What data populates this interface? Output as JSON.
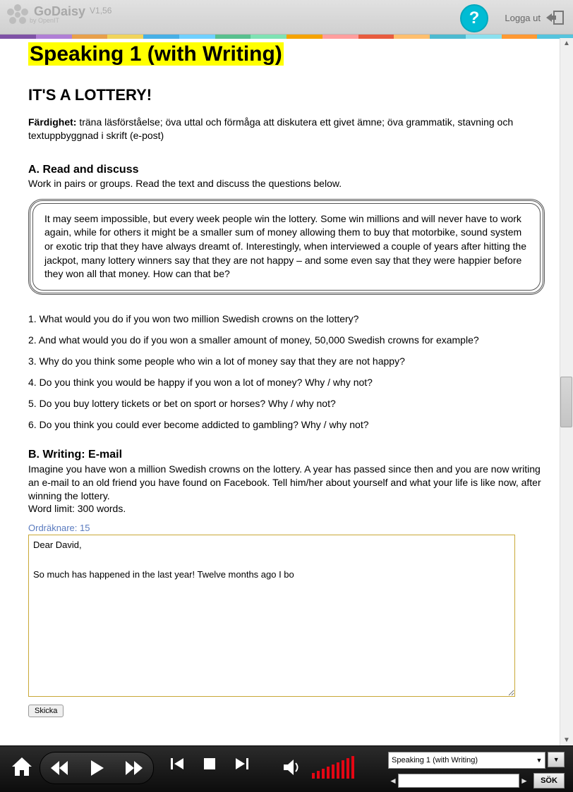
{
  "header": {
    "brand": "GoDaisy",
    "byline": "by OpenIT",
    "version": "V1,56",
    "logout_label": "Logga ut"
  },
  "stripe_colors": [
    "#7f52a6",
    "#b07fd5",
    "#e8a04b",
    "#f0d45c",
    "#47b0e6",
    "#6fd0ff",
    "#58c08e",
    "#7fe2b3",
    "#f5a300",
    "#ff9e9e",
    "#e85c3f",
    "#ffbf6e",
    "#4dbad0",
    "#8be0ee",
    "#ff9933",
    "#55c4dd"
  ],
  "page_title": "Speaking 1 (with Writing)",
  "subtitle": "IT'S A LOTTERY!",
  "skill_label": "Färdighet:",
  "skill_text": "träna läsförståelse; öva uttal och förmåga att diskutera ett givet ämne; öva grammatik, stavning och textuppbyggnad i skrift (e-post)",
  "sectionA_title": "A. Read and discuss",
  "sectionA_instr": "Work in pairs or groups. Read the text and discuss the questions below.",
  "read_box": "It may seem impossible, but every week people win the lottery. Some win millions and will never have to work again, while for others it might be a smaller sum of money allowing them to buy that motorbike, sound system or exotic trip that they have always dreamt of. Interestingly, when interviewed a couple of years after hitting the jackpot, many lottery winners say that they are not happy – and some even say that they were happier before they won all that money. How can that be?",
  "questions": [
    "1. What would you do if you won two million Swedish crowns on the lottery?",
    "2. And what would you do if you won a smaller amount of money, 50,000 Swedish crowns for example?",
    "3. Why do you think some people who win a lot of money say that they are not happy?",
    "4. Do you think you would be happy if you won a lot of money? Why / why not?",
    "5. Do you buy lottery tickets or bet on sport or horses? Why / why not?",
    "6. Do you think you could ever become addicted to gambling? Why / why not?"
  ],
  "sectionB_title": "B. Writing: E-mail",
  "sectionB_instr": "Imagine you have won a million Swedish crowns on the lottery. A year has passed since then and you are now writing an e-mail to an old friend you have found on Facebook. Tell him/her about yourself and what your life is like now, after winning the lottery.",
  "word_limit": "Word limit: 300 words.",
  "word_counter_label": "Ordräknare: 15",
  "textarea_value": "Dear David,\n\nSo much has happened in the last year! Twelve months ago I bo",
  "submit_label": "Skicka",
  "player": {
    "chapter_selected": "Speaking 1 (with Writing)",
    "search_label": "SÖK",
    "search_value": ""
  }
}
